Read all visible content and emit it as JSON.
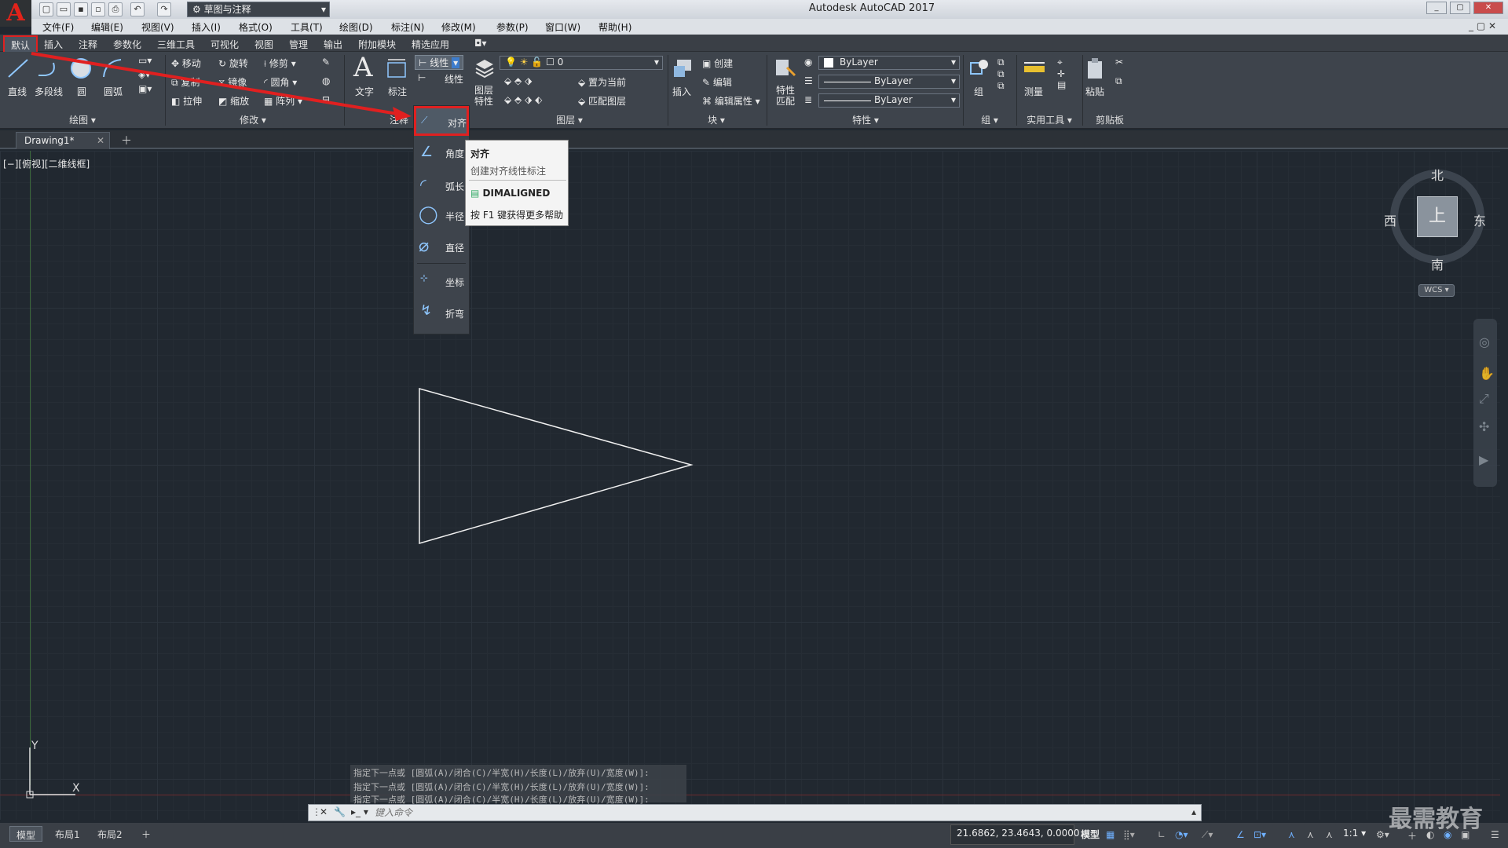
{
  "app_title": "Autodesk AutoCAD 2017",
  "workspace": "草图与注释",
  "menus": [
    "文件(F)",
    "编辑(E)",
    "视图(V)",
    "插入(I)",
    "格式(O)",
    "工具(T)",
    "绘图(D)",
    "标注(N)",
    "修改(M)",
    "参数(P)",
    "窗口(W)",
    "帮助(H)"
  ],
  "ribbon_tabs": [
    "默认",
    "插入",
    "注释",
    "参数化",
    "三维工具",
    "可视化",
    "视图",
    "管理",
    "输出",
    "附加模块",
    "精选应用"
  ],
  "draw_panel": {
    "line": "直线",
    "polyline": "多段线",
    "circle": "圆",
    "arc": "圆弧",
    "title": "绘图"
  },
  "modify_panel": {
    "move": "移动",
    "rotate": "旋转",
    "trim": "修剪",
    "copy": "复制",
    "mirror": "镜像",
    "fillet": "圆角",
    "stretch": "拉伸",
    "scale": "缩放",
    "array": "阵列",
    "title": "修改"
  },
  "annotation_panel": {
    "text": "文字",
    "dimension": "标注",
    "linear_split": "线性",
    "linear": "线性",
    "title": "注释"
  },
  "layers_panel": {
    "layer_props": "图层特性",
    "layer_value": "0",
    "make_current": "置为当前",
    "match_layer": "匹配图层",
    "title": "图层"
  },
  "block_panel": {
    "insert": "插入",
    "create": "创建",
    "edit": "编辑",
    "edit_attr": "编辑属性",
    "title": "块"
  },
  "properties_panel": {
    "match_props": "特性匹配",
    "color": "ByLayer",
    "linetype": "ByLayer",
    "lineweight": "ByLayer",
    "title": "特性"
  },
  "groups_panel": {
    "group": "组",
    "title": "组"
  },
  "utilities_panel": {
    "measure": "测量",
    "title": "实用工具"
  },
  "clipboard_panel": {
    "paste": "粘贴",
    "title": "剪贴板"
  },
  "document_tab": "Drawing1*",
  "viewport_label": "[−][俯视][二维线框]",
  "dim_dropdown": [
    "对齐",
    "角度",
    "弧长",
    "半径",
    "直径",
    "坐标",
    "折弯"
  ],
  "tooltip": {
    "title": "对齐",
    "desc": "创建对齐线性标注",
    "command": "DIMALIGNED",
    "help": "按 F1 键获得更多帮助"
  },
  "viewcube": {
    "north": "北",
    "south": "南",
    "east": "东",
    "west": "西",
    "face": "上",
    "wcs": "WCS"
  },
  "ucs": {
    "x": "X",
    "y": "Y"
  },
  "command_history": [
    "指定下一点或 [圆弧(A)/闭合(C)/半宽(H)/长度(L)/放弃(U)/宽度(W)]:",
    "指定下一点或 [圆弧(A)/闭合(C)/半宽(H)/长度(L)/放弃(U)/宽度(W)]:",
    "指定下一点或 [圆弧(A)/闭合(C)/半宽(H)/长度(L)/放弃(U)/宽度(W)]:"
  ],
  "command_placeholder": "键入命令",
  "layout_tabs": [
    "模型",
    "布局1",
    "布局2"
  ],
  "coordinates": "21.6862, 23.4643, 0.0000",
  "status_model": "模型",
  "annotation_scale": "1:1",
  "watermark": "最需教育",
  "colors": {
    "accent_red": "#e02020",
    "canvas": "#212830",
    "ribbon": "#3e444c"
  }
}
